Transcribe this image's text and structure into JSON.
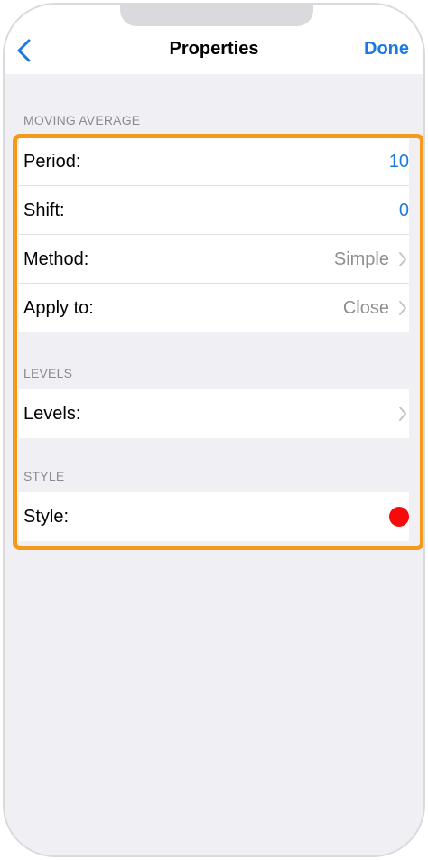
{
  "nav": {
    "title": "Properties",
    "done_label": "Done",
    "back_icon": "chevron-left-icon"
  },
  "sections": {
    "moving_average": {
      "header": "MOVING AVERAGE",
      "rows": [
        {
          "label": "Period:",
          "value": "10"
        },
        {
          "label": "Shift:",
          "value": "0"
        },
        {
          "label": "Method:",
          "value": "Simple"
        },
        {
          "label": "Apply to:",
          "value": "Close"
        }
      ]
    },
    "levels": {
      "header": "LEVELS",
      "rows": [
        {
          "label": "Levels:",
          "value": ""
        }
      ]
    },
    "style": {
      "header": "STYLE",
      "rows": [
        {
          "label": "Style:",
          "color": "#f50b0b"
        }
      ]
    }
  },
  "colors": {
    "accent": "#1a7ae0",
    "highlight": "#f39a1d"
  }
}
